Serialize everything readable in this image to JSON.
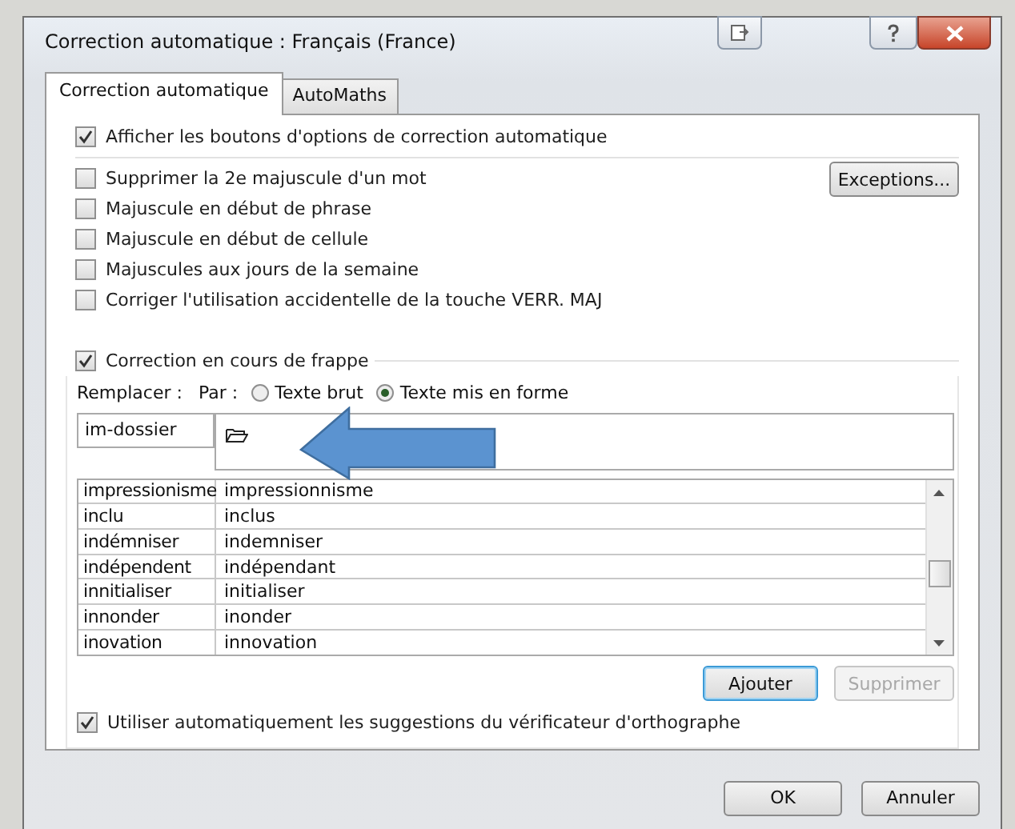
{
  "window": {
    "title": "Correction automatique : Français (France)"
  },
  "tabs": [
    {
      "label": "Correction automatique",
      "selected": true
    },
    {
      "label": "AutoMaths",
      "selected": false
    }
  ],
  "show_options": {
    "label": "Afficher les boutons d'options de correction automatique",
    "checked": true
  },
  "options": [
    {
      "label": "Supprimer la 2e majuscule d'un mot",
      "checked": false
    },
    {
      "label": "Majuscule en début de phrase",
      "checked": false
    },
    {
      "label": "Majuscule en début de cellule",
      "checked": false
    },
    {
      "label": "Majuscules aux jours de la semaine",
      "checked": false
    },
    {
      "label": "Corriger l'utilisation accidentelle de la touche VERR. MAJ",
      "checked": false
    }
  ],
  "exceptions_button": "Exceptions...",
  "replace_as_you_type": {
    "label": "Correction en cours de frappe",
    "checked": true
  },
  "replace_label": "Remplacer :",
  "with_label": "Par :",
  "formats": [
    {
      "label": "Texte brut",
      "selected": false
    },
    {
      "label": "Texte mis en forme",
      "selected": true
    }
  ],
  "replace_value": "im-dossier",
  "entries": [
    {
      "replace": "impressionisme",
      "with": "impressionnisme"
    },
    {
      "replace": "inclu",
      "with": "inclus"
    },
    {
      "replace": "indémniser",
      "with": "indemniser"
    },
    {
      "replace": "indépendent",
      "with": "indépendant"
    },
    {
      "replace": "innitialiser",
      "with": "initialiser"
    },
    {
      "replace": "innonder",
      "with": "inonder"
    },
    {
      "replace": "inovation",
      "with": "innovation"
    }
  ],
  "list_buttons": [
    {
      "label": "Ajouter",
      "disabled": false
    },
    {
      "label": "Supprimer",
      "disabled": true
    }
  ],
  "use_spellchecker": {
    "label": "Utiliser automatiquement les suggestions du vérificateur d'orthographe",
    "checked": true
  },
  "dialog_buttons": [
    "OK",
    "Annuler"
  ]
}
